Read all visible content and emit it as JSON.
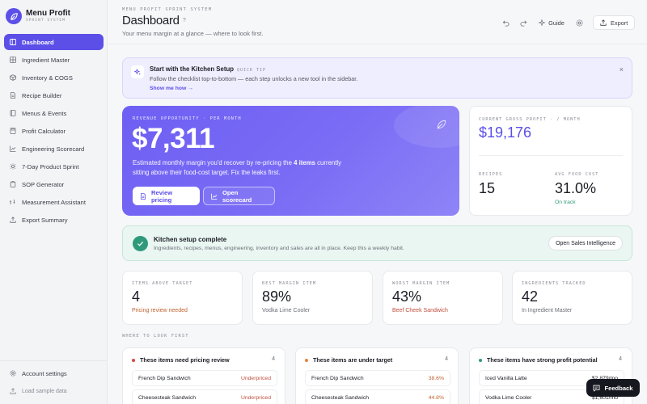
{
  "brand": {
    "name": "Menu Profit",
    "sub": "SPRINT SYSTEM"
  },
  "sidebar": {
    "items": [
      {
        "label": "Dashboard",
        "icon": "layout-icon"
      },
      {
        "label": "Ingredient Master",
        "icon": "grid-icon"
      },
      {
        "label": "Inventory & COGS",
        "icon": "box-icon"
      },
      {
        "label": "Recipe Builder",
        "icon": "document-icon"
      },
      {
        "label": "Menus & Events",
        "icon": "book-icon"
      },
      {
        "label": "Profit Calculator",
        "icon": "calculator-icon"
      },
      {
        "label": "Engineering Scorecard",
        "icon": "chart-icon"
      },
      {
        "label": "7-Day Product Sprint",
        "icon": "sun-icon"
      },
      {
        "label": "SOP Generator",
        "icon": "clipboard-icon"
      },
      {
        "label": "Measurement Assistant",
        "icon": "scale-icon"
      },
      {
        "label": "Export Summary",
        "icon": "upload-icon"
      }
    ],
    "bottom": {
      "settings": "Account settings",
      "sample": "Load sample data"
    }
  },
  "header": {
    "eyebrow": "MENU PROFIT SPRINT SYSTEM",
    "title": "Dashboard",
    "help": "?",
    "subtitle": "Your menu margin at a glance — where to look first.",
    "guide": "Guide",
    "export": "Export"
  },
  "tip": {
    "title": "Start with the Kitchen Setup",
    "badge": "QUICK TIP",
    "body": "Follow the checklist top-to-bottom — each step unlocks a new tool in the sidebar.",
    "link": "Show me how →",
    "close": "×"
  },
  "hero": {
    "eyebrow": "REVENUE OPPORTUNITY · PER MONTH",
    "value": "$7,311",
    "desc_pre": "Estimated monthly margin you'd recover by re-pricing the ",
    "desc_bold": "4 items",
    "desc_post": " currently sitting above their food-cost target. Fix the leaks first.",
    "btn_review": "Review pricing",
    "btn_scorecard": "Open scorecard"
  },
  "stats": {
    "gp_label": "CURRENT GROSS PROFIT · / MONTH",
    "gp_value": "$19,176",
    "recipes_label": "RECIPES",
    "recipes_value": "15",
    "food_cost_label": "AVG FOOD COST",
    "food_cost_value": "31.0%",
    "food_cost_status": "On track"
  },
  "success": {
    "title": "Kitchen setup complete",
    "body": "Ingredients, recipes, menus, engineering, inventory and sales are all in place. Keep this a weekly habit.",
    "button": "Open Sales Intelligence"
  },
  "kpis": [
    {
      "label": "ITEMS ABOVE TARGET",
      "value": "4",
      "sub": "Pricing review needed",
      "color": "#c0622f"
    },
    {
      "label": "BEST MARGIN ITEM",
      "value": "89%",
      "sub": "Vodka Lime Cooler",
      "color": "#6d7079"
    },
    {
      "label": "WORST MARGIN ITEM",
      "value": "43%",
      "sub": "Beef Cheek Sandwich",
      "color": "#c0503f"
    },
    {
      "label": "INGREDIENTS TRACKED",
      "value": "42",
      "sub": "In Ingredient Master",
      "color": "#6d7079"
    }
  ],
  "where": {
    "label": "WHERE TO LOOK FIRST",
    "panels": [
      {
        "title": "These items need pricing review",
        "count": "4",
        "dot": "#d64545",
        "rows": [
          {
            "name": "French Dip Sandwich",
            "value": "Underpriced"
          },
          {
            "name": "Cheesesteak Sandwich",
            "value": "Underpriced"
          }
        ],
        "value_color": "#c0503f"
      },
      {
        "title": "These items are under target",
        "count": "4",
        "dot": "#e8833a",
        "rows": [
          {
            "name": "French Dip Sandwich",
            "value": "38.6%"
          },
          {
            "name": "Cheesesteak Sandwich",
            "value": "44.8%"
          }
        ],
        "value_color": "#c0622f"
      },
      {
        "title": "These items have strong profit potential",
        "count": "4",
        "dot": "#2f9a7a",
        "rows": [
          {
            "name": "Iced Vanilla Latte",
            "value": "$2,879/mo"
          },
          {
            "name": "Vodka Lime Cooler",
            "value": "$1,601/mo"
          }
        ],
        "value_color": "#1b1d24"
      }
    ]
  },
  "feedback": "Feedback",
  "colors": {
    "accent": "#5b4fe8",
    "success": "#2f9a7a",
    "danger": "#c0503f"
  }
}
